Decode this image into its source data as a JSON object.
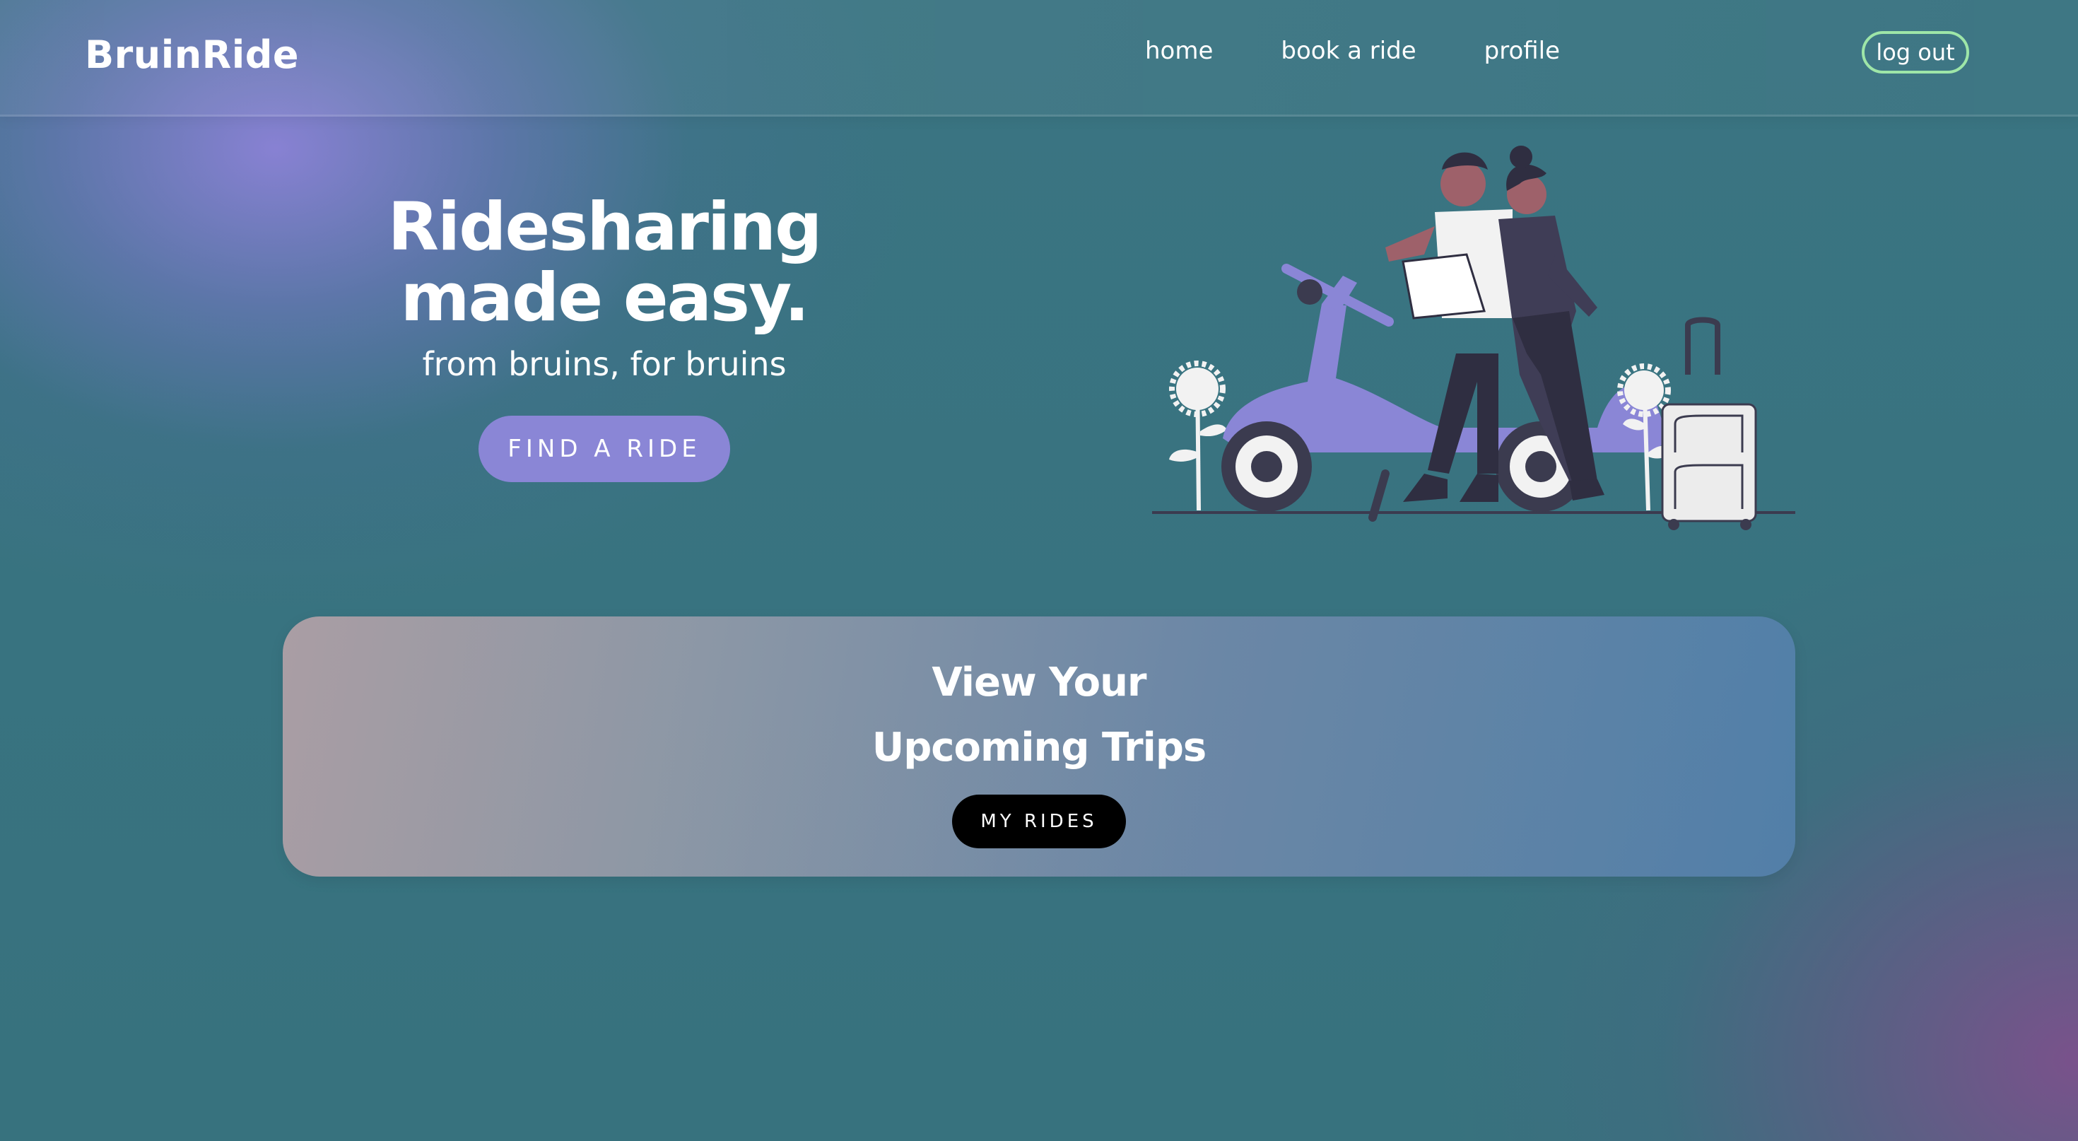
{
  "brand": {
    "name": "BruinRide"
  },
  "nav": {
    "links": [
      {
        "label": "home"
      },
      {
        "label": "book a ride"
      },
      {
        "label": "profile"
      }
    ],
    "logout_label": "log out"
  },
  "hero": {
    "title_line1": "Ridesharing",
    "title_line2": "made easy.",
    "subtitle": "from bruins, for bruins",
    "cta_label": "FIND A RIDE",
    "illustration": "scooter-riders-illustration"
  },
  "trips_card": {
    "title_line1": "View Your",
    "title_line2": "Upcoming Trips",
    "button_label": "MY RIDES"
  },
  "colors": {
    "accent_purple": "#8a86d6",
    "logout_border": "#9ee6a8",
    "background_teal": "#37727e",
    "button_dark": "#000000"
  }
}
